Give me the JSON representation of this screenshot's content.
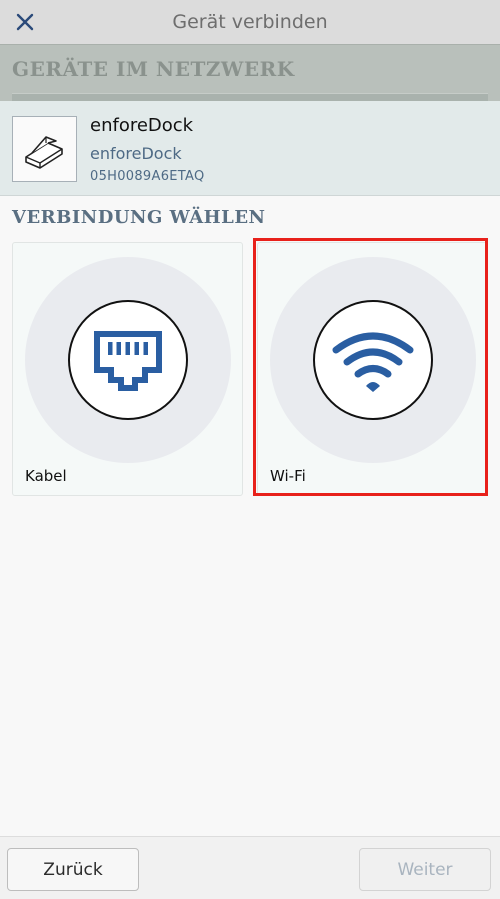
{
  "header": {
    "title": "Gerät verbinden",
    "close_icon": "close-icon"
  },
  "network": {
    "section_label": "GERÄTE IM NETZWERK"
  },
  "device": {
    "icon": "printer-device-icon",
    "name": "enforeDock",
    "model": "enforeDock",
    "serial": "05H0089A6ETAQ"
  },
  "connection": {
    "section_label": "VERBINDUNG WÄHLEN",
    "options": [
      {
        "label": "Kabel",
        "icon": "ethernet-port-icon",
        "selected": false
      },
      {
        "label": "Wi-Fi",
        "icon": "wifi-icon",
        "selected": true
      }
    ]
  },
  "footer": {
    "back_label": "Zurück",
    "next_label": "Weiter"
  },
  "colors": {
    "accent_blue": "#2a5ea2",
    "selection_red": "#e8211b",
    "section_text": "#5a6f82"
  }
}
